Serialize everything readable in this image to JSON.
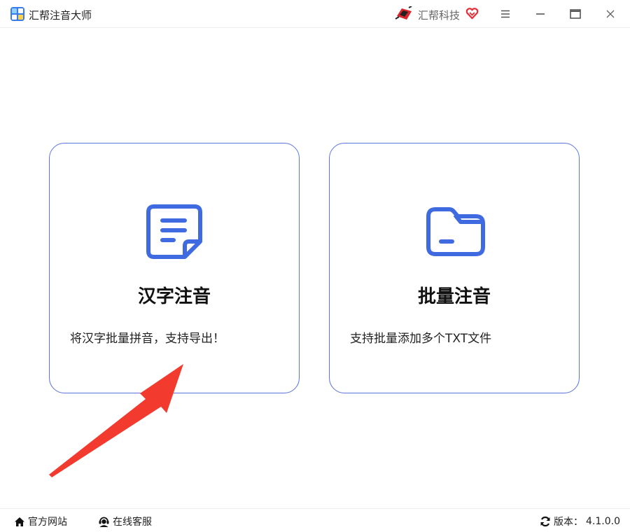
{
  "window": {
    "app_title": "汇帮注音大师",
    "app_icon": "app-logo-icon",
    "brand_name": "汇帮科技",
    "brand_logo": "huibang-logo-icon",
    "brand_badge": "heart-badge-icon",
    "controls": [
      "menu-icon",
      "minimize-icon",
      "maximize-icon",
      "close-icon"
    ]
  },
  "cards": {
    "hanzi": {
      "icon": "document-icon",
      "title": "汉字注音",
      "description": "将汉字批量拼音，支持导出！"
    },
    "batch": {
      "icon": "folder-icon",
      "title": "批量注音",
      "description": "支持批量添加多个TXT文件"
    }
  },
  "annotation": {
    "icon": "red-arrow-icon"
  },
  "footer": {
    "official_site": "官方网站",
    "online_service": "在线客服",
    "version_label": "版本：",
    "version_value": "4.1.0.0"
  },
  "colors": {
    "accent": "#3f6ae0",
    "card_border": "#5b74d9",
    "arrow": "#f23a2f"
  }
}
